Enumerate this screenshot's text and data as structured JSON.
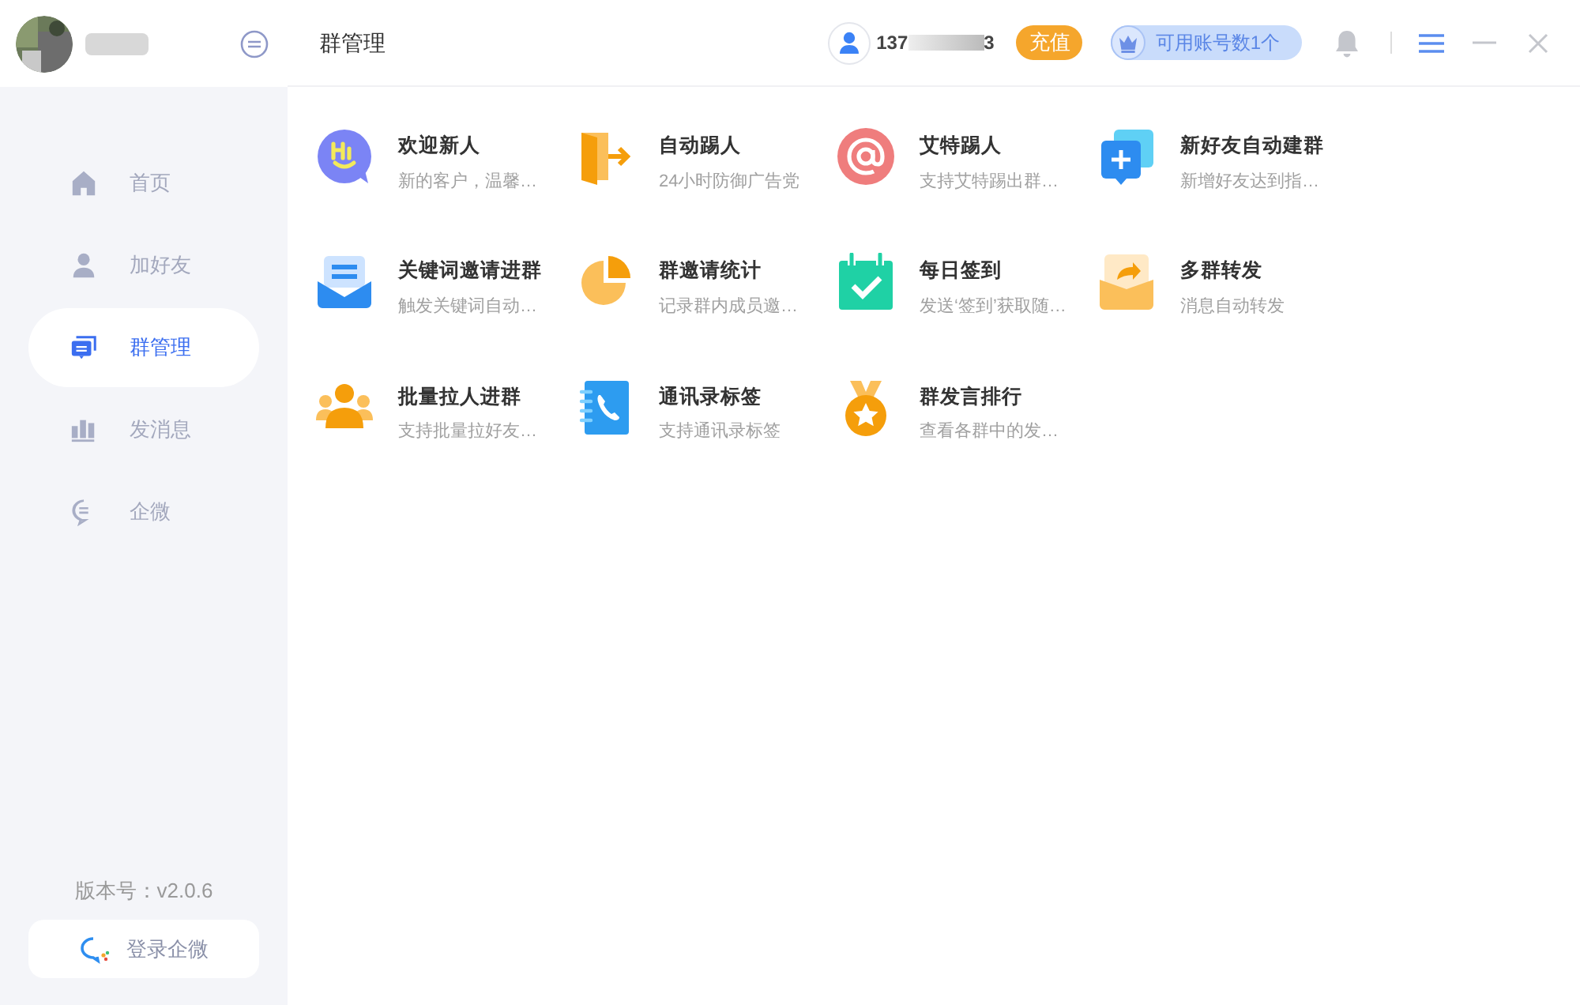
{
  "sidebar": {
    "items": [
      {
        "kind": "home",
        "label": "首页",
        "selected": false
      },
      {
        "kind": "friend",
        "label": "加好友",
        "selected": false
      },
      {
        "kind": "group",
        "label": "群管理",
        "selected": true
      },
      {
        "kind": "message",
        "label": "发消息",
        "selected": false
      },
      {
        "kind": "wecom",
        "label": "企微",
        "selected": false
      }
    ],
    "version": "版本号：v2.0.6",
    "login_button": "登录企微"
  },
  "header": {
    "title": "群管理",
    "phone_start": "137",
    "phone_end": "3",
    "recharge": "充值",
    "accounts": "可用账号数1个"
  },
  "features": [
    {
      "kind": "hi",
      "title": "欢迎新人",
      "desc": "新的客户，温馨…"
    },
    {
      "kind": "exit",
      "title": "自动踢人",
      "desc": "24小时防御广告党"
    },
    {
      "kind": "at",
      "title": "艾特踢人",
      "desc": "支持艾特踢出群…"
    },
    {
      "kind": "newgroup",
      "title": "新好友自动建群",
      "desc": "新增好友达到指…"
    },
    {
      "kind": "keyword",
      "title": "关键词邀请进群",
      "desc": "触发关键词自动…"
    },
    {
      "kind": "pie",
      "title": "群邀请统计",
      "desc": "记录群内成员邀…"
    },
    {
      "kind": "checkin",
      "title": "每日签到",
      "desc": "发送‘签到’获取随…"
    },
    {
      "kind": "forward",
      "title": "多群转发",
      "desc": "消息自动转发"
    },
    {
      "kind": "people",
      "title": "批量拉人进群",
      "desc": "支持批量拉好友…"
    },
    {
      "kind": "contacts",
      "title": "通讯录标签",
      "desc": "支持通讯录标签"
    },
    {
      "kind": "medal",
      "title": "群发言排行",
      "desc": "查看各群中的发…"
    }
  ]
}
